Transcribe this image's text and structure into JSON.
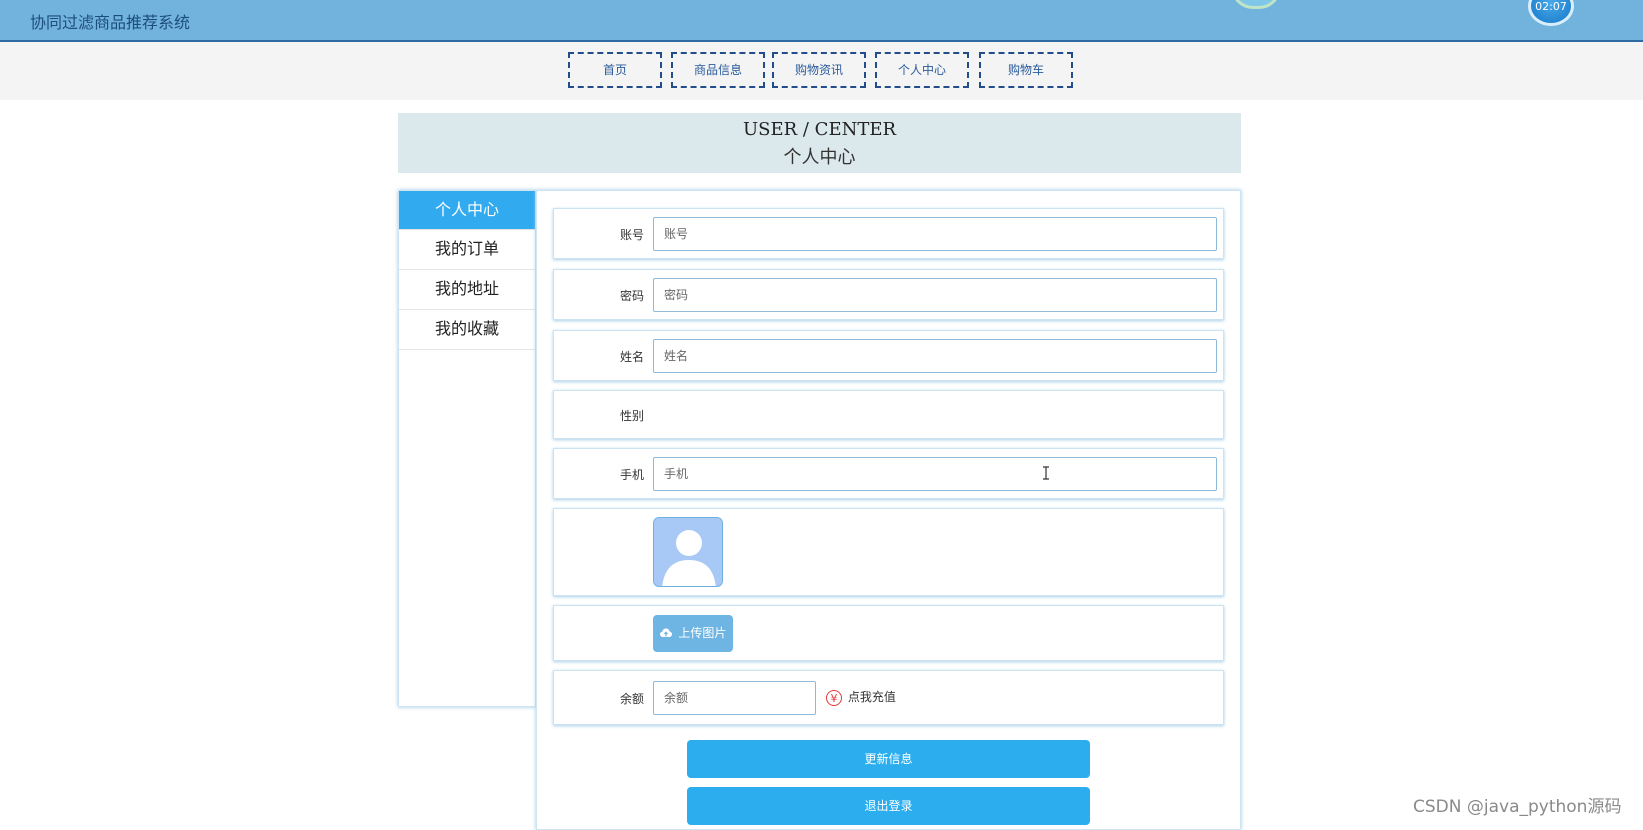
{
  "header": {
    "title": "协同过滤商品推荐系统",
    "clock": "02:07"
  },
  "nav": {
    "items": [
      {
        "label": "首页"
      },
      {
        "label": "商品信息"
      },
      {
        "label": "购物资讯"
      },
      {
        "label": "个人中心"
      },
      {
        "label": "购物车"
      }
    ]
  },
  "banner": {
    "en": "USER / CENTER",
    "cn": "个人中心"
  },
  "sidebar": {
    "items": [
      {
        "label": "个人中心",
        "active": true
      },
      {
        "label": "我的订单"
      },
      {
        "label": "我的地址"
      },
      {
        "label": "我的收藏"
      }
    ]
  },
  "form": {
    "account": {
      "label": "账号",
      "placeholder": "账号",
      "value": ""
    },
    "password": {
      "label": "密码",
      "placeholder": "密码",
      "value": ""
    },
    "name": {
      "label": "姓名",
      "placeholder": "姓名",
      "value": ""
    },
    "gender": {
      "label": "性别"
    },
    "phone": {
      "label": "手机",
      "placeholder": "手机",
      "value": ""
    },
    "upload_label": "上传图片",
    "balance": {
      "label": "余额",
      "placeholder": "余额",
      "value": ""
    },
    "recharge_label": "点我充值",
    "update_label": "更新信息",
    "logout_label": "退出登录"
  },
  "colors": {
    "header_bg": "#71b3dd",
    "nav_border": "#224d8a",
    "active_sidebar": "#31aaf0",
    "primary_button": "#2caeee",
    "upload_button": "#6fb5e3"
  },
  "icons": {
    "upload": "cloud-upload-icon",
    "recharge": "yen-icon",
    "avatar": "user-avatar-icon"
  },
  "watermark": "CSDN @java_python源码"
}
